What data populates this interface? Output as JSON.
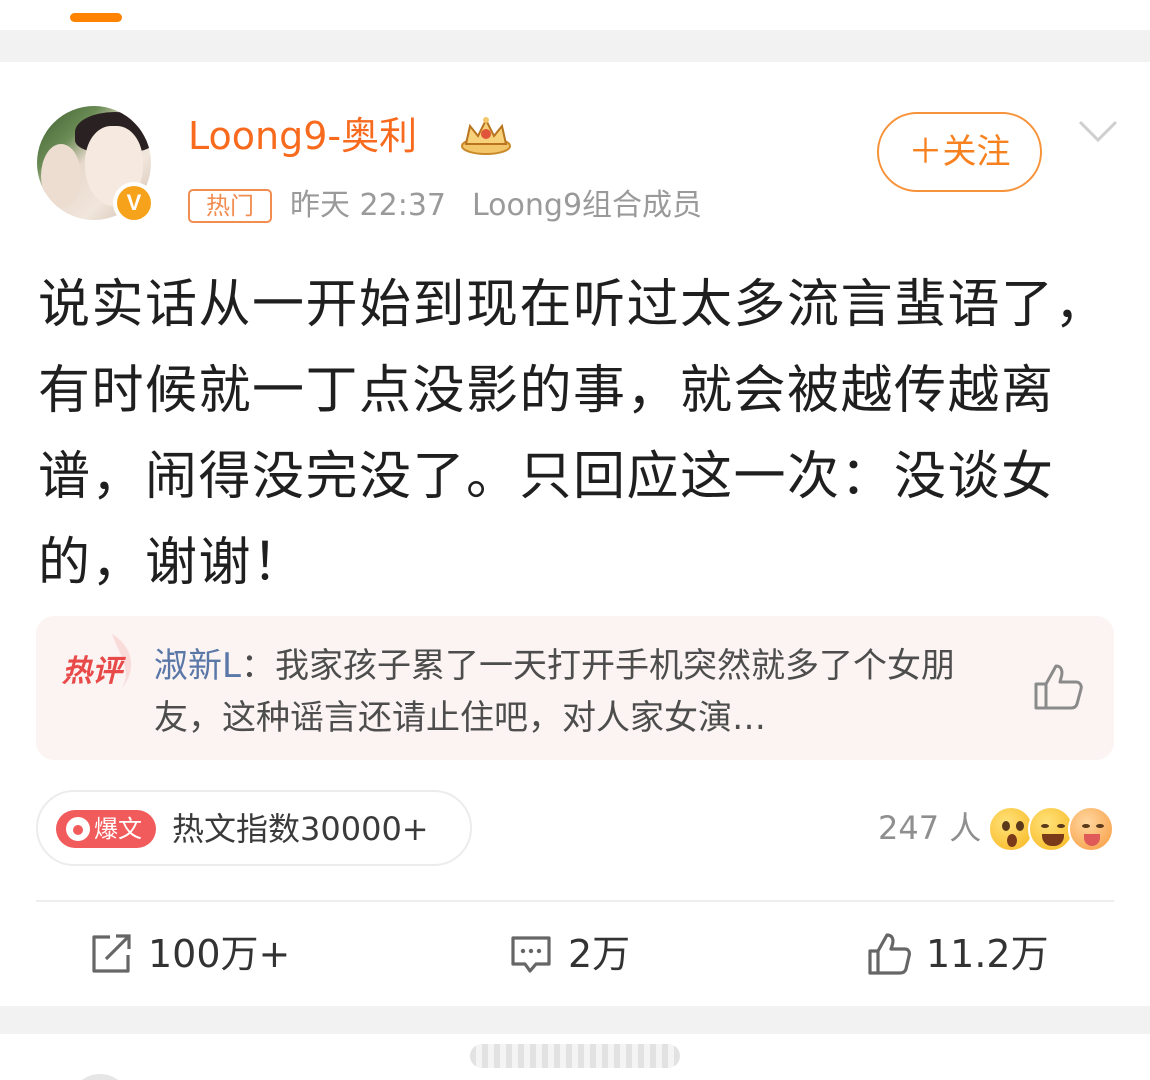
{
  "colors": {
    "accent": "#ff8200",
    "username": "#f86a1d",
    "follow_border": "#f7933b",
    "hot_comment_bg": "#fbf4f2",
    "trend_badge": "#f25b5b",
    "comment_author": "#5a77a8"
  },
  "header": {
    "active_tab_indicator": true
  },
  "post": {
    "author": {
      "name": "Loong9-奥利",
      "verified_badge": "V",
      "avatar_icon": "avatar",
      "rank_icon": "crown-icon"
    },
    "hot_tag": "热门",
    "time": "昨天 22:37",
    "author_desc": "Loong9组合成员",
    "follow_label": "＋关注",
    "more_icon": "chevron-down-icon",
    "text": "说实话从一开始到现在听过太多流言蜚语了，有时候就一丁点没影的事，就会被越传越离谱，闹得没完没了。只回应这一次：没谈女的，谢谢！",
    "hot_comment": {
      "badge": "热评",
      "author": "淑新L",
      "separator": "：",
      "text": "我家孩子累了一天打开手机突然就多了个女朋友，这种谣言还请止住吧，对人家女演…",
      "like_icon": "thumbs-up-icon"
    },
    "trend": {
      "badge": "爆文",
      "text": "热文指数30000+"
    },
    "reactions": {
      "count_label": "247 人",
      "emojis": [
        "wow-emoji",
        "laugh-emoji",
        "hug-emoji"
      ]
    },
    "actions": {
      "repost": {
        "icon": "repost-icon",
        "count": "100万+"
      },
      "comment": {
        "icon": "comment-icon",
        "count": "2万"
      },
      "like": {
        "icon": "thumbs-up-icon",
        "count": "11.2万"
      }
    }
  }
}
